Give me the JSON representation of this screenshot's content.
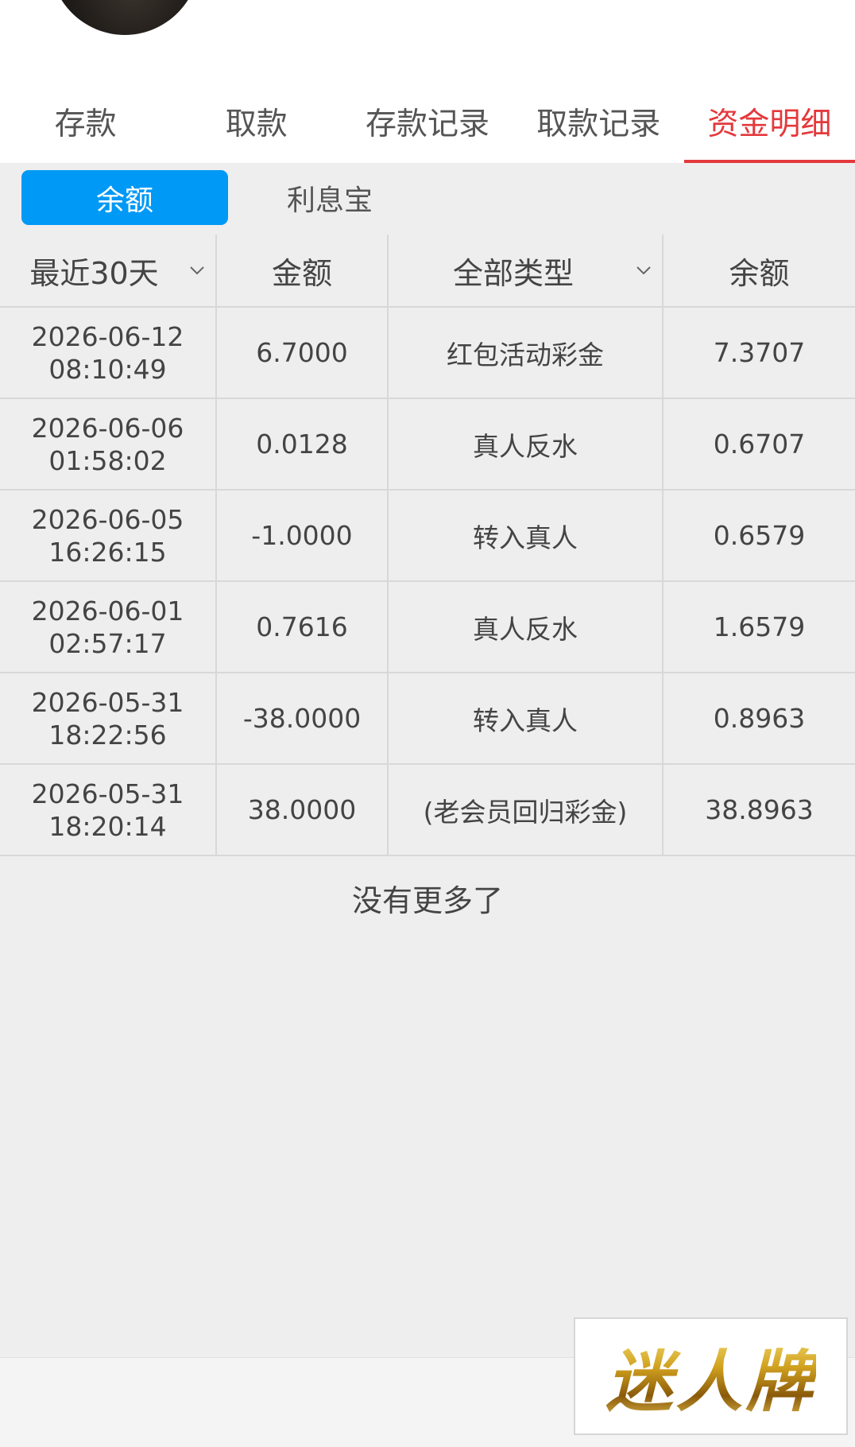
{
  "main_tabs": [
    {
      "label": "存款",
      "active": false
    },
    {
      "label": "取款",
      "active": false
    },
    {
      "label": "存款记录",
      "active": false
    },
    {
      "label": "取款记录",
      "active": false
    },
    {
      "label": "资金明细",
      "active": true
    }
  ],
  "sub_tabs": [
    {
      "label": "余额",
      "active": true
    },
    {
      "label": "利息宝",
      "active": false
    }
  ],
  "table": {
    "headers": {
      "period": "最近30天",
      "amount": "金额",
      "type": "全部类型",
      "balance": "余额"
    },
    "rows": [
      {
        "date": "2026-06-12",
        "time": "08:10:49",
        "amount": "6.7000",
        "type": "红包活动彩金",
        "balance": "7.3707"
      },
      {
        "date": "2026-06-06",
        "time": "01:58:02",
        "amount": "0.0128",
        "type": "真人反水",
        "balance": "0.6707"
      },
      {
        "date": "2026-06-05",
        "time": "16:26:15",
        "amount": "-1.0000",
        "type": "转入真人",
        "balance": "0.6579"
      },
      {
        "date": "2026-06-01",
        "time": "02:57:17",
        "amount": "0.7616",
        "type": "真人反水",
        "balance": "1.6579"
      },
      {
        "date": "2026-05-31",
        "time": "18:22:56",
        "amount": "-38.0000",
        "type": "转入真人",
        "balance": "0.8963"
      },
      {
        "date": "2026-05-31",
        "time": "18:20:14",
        "amount": "38.0000",
        "type": "(老会员回归彩金)",
        "balance": "38.8963"
      }
    ]
  },
  "no_more_text": "没有更多了",
  "watermark": {
    "text": "迷人牌"
  },
  "colors": {
    "accent_red": "#e4393c",
    "active_blue": "#0099f5",
    "background": "#eeeeee"
  }
}
